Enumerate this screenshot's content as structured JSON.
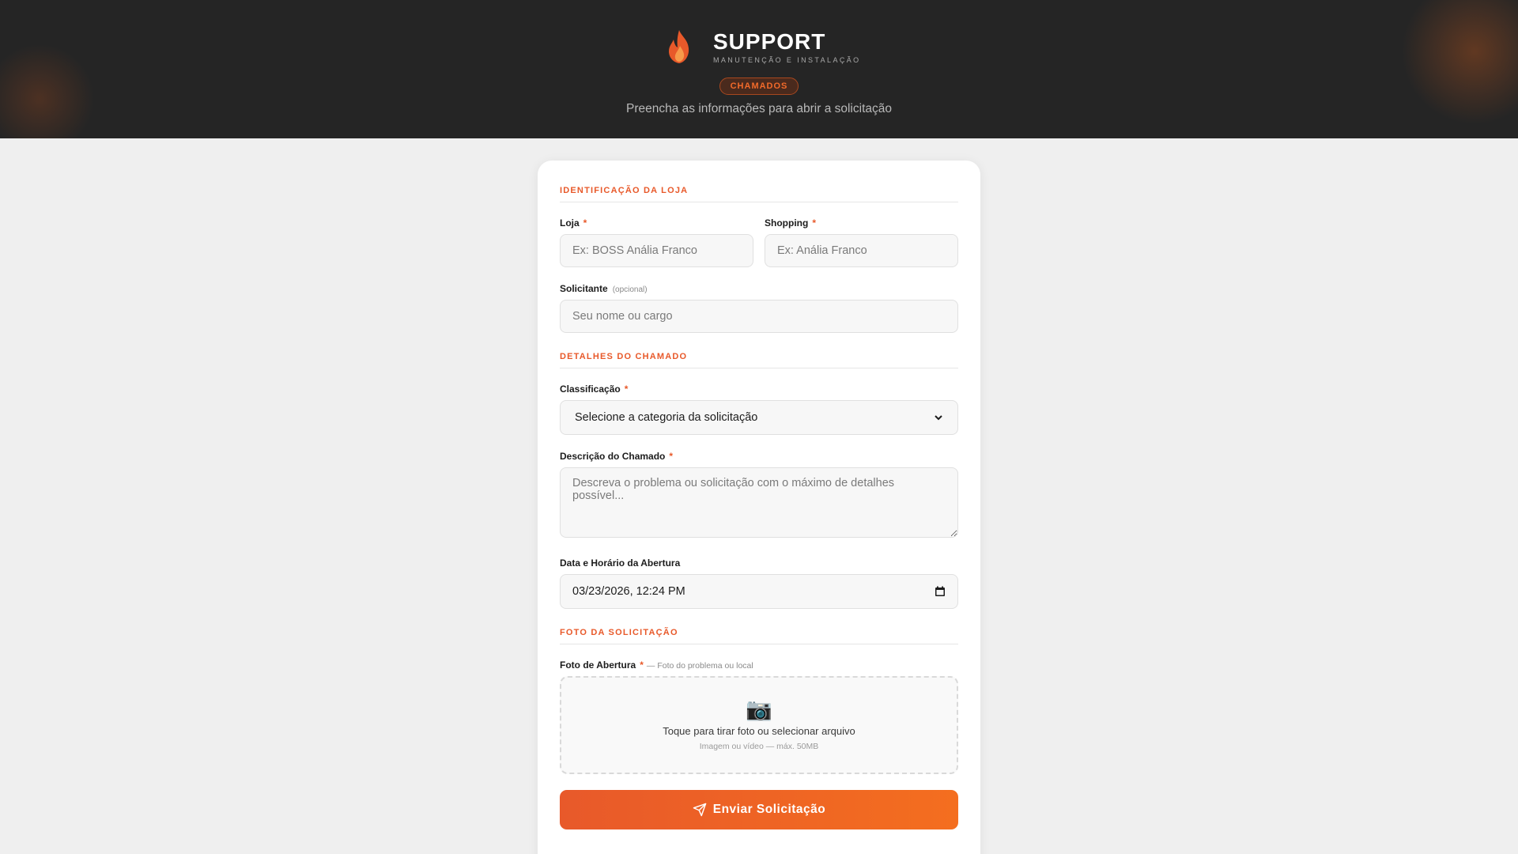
{
  "header": {
    "title": "SUPPORT",
    "subtitle": "MANUTENÇÃO E INSTALAÇÃO",
    "badge": "CHAMADOS",
    "instructions": "Preencha as informações para abrir a solicitação"
  },
  "sections": {
    "store": "IDENTIFICAÇÃO DA LOJA",
    "details": "DETALHES DO CHAMADO",
    "photo": "FOTO DA SOLICITAÇÃO"
  },
  "fields": {
    "loja": {
      "label": "Loja",
      "required": "*",
      "placeholder": "Ex: BOSS Anália Franco"
    },
    "shopping": {
      "label": "Shopping",
      "required": "*",
      "placeholder": "Ex: Anália Franco"
    },
    "solicitante": {
      "label": "Solicitante",
      "optional": "(opcional)",
      "placeholder": "Seu nome ou cargo"
    },
    "classificacao": {
      "label": "Classificação",
      "required": "*",
      "selected": "Selecione a categoria da solicitação"
    },
    "descricao": {
      "label": "Descrição do Chamado",
      "required": "*",
      "placeholder": "Descreva o problema ou solicitação com o máximo de detalhes possível..."
    },
    "data_hora": {
      "label": "Data e Horário da Abertura",
      "value": "03/23/2026, 12:24 PM"
    },
    "foto": {
      "label": "Foto de Abertura",
      "required": "*",
      "hint": "— Foto do problema ou local",
      "upload_text": "Toque para tirar foto ou selecionar arquivo",
      "upload_subtext": "Imagem ou vídeo — máx. 50MB",
      "icon": "camera-icon"
    }
  },
  "submit": {
    "label": "Enviar Solicitação",
    "icon": "send-icon"
  },
  "colors": {
    "accent": "#e8592a",
    "header_bg": "#252525",
    "page_bg": "#efefef"
  }
}
